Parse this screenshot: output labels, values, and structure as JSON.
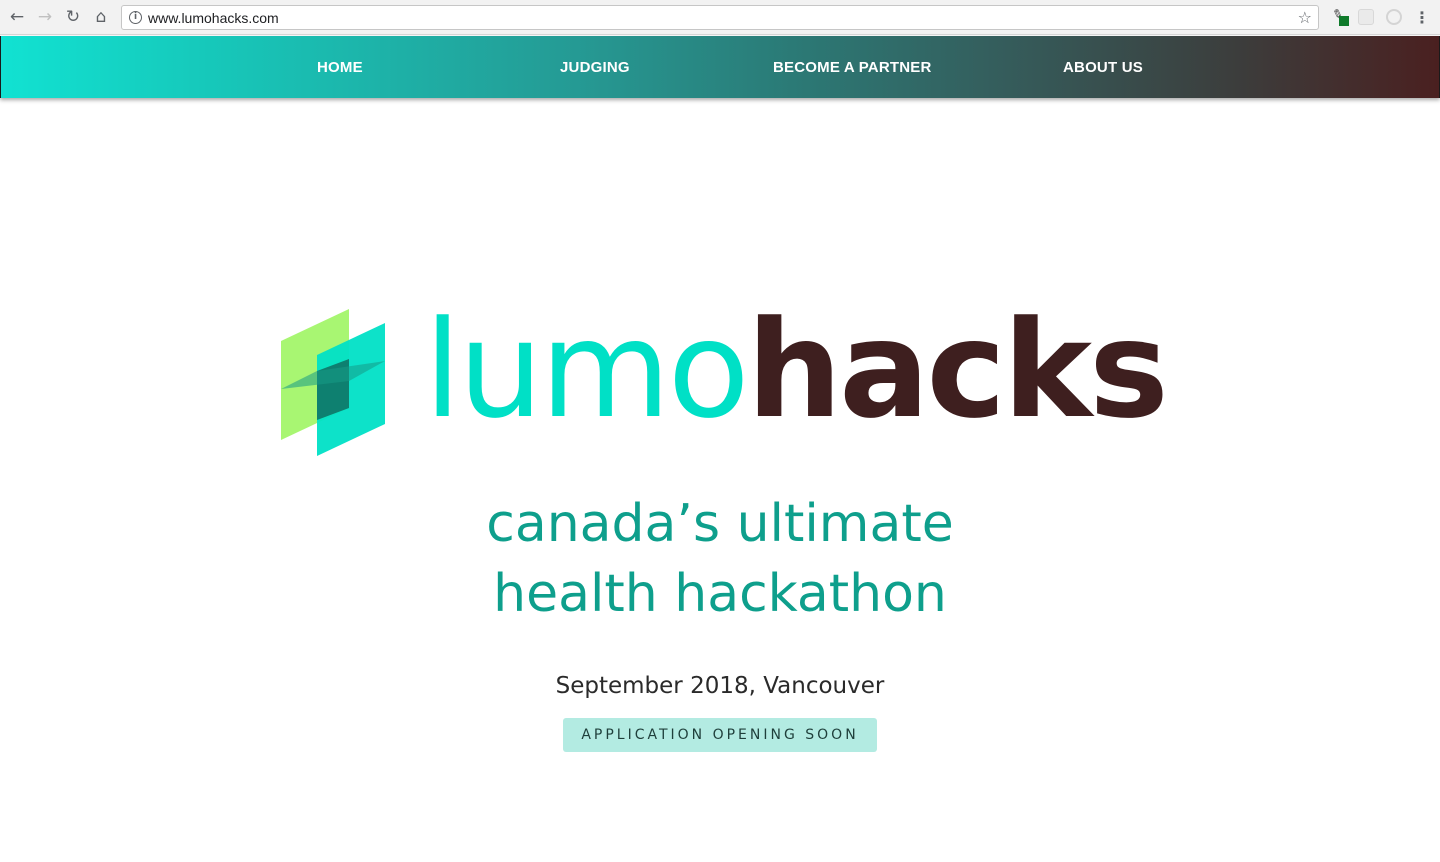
{
  "browser": {
    "back_icon": "←",
    "forward_icon": "→",
    "reload_icon": "↻",
    "home_icon": "⌂",
    "url": "www.lumohacks.com",
    "info_icon": "i",
    "star_icon": "☆",
    "menu_icon": "⋮"
  },
  "nav": {
    "items": [
      {
        "label": "HOME"
      },
      {
        "label": "JUDGING"
      },
      {
        "label": "BECOME A PARTNER"
      },
      {
        "label": "ABOUT US"
      }
    ],
    "gradient_start": "#11e2d2",
    "gradient_end": "#4a2020"
  },
  "hero": {
    "logo_part1": "lumo",
    "logo_part2": "hacks",
    "tagline_line1": "canada’s ultimate",
    "tagline_line2": "health hackathon",
    "date_location": "September 2018, Vancouver",
    "cta_label": "APPLICATION OPENING SOON"
  },
  "colors": {
    "lumo": "#00e0c6",
    "hacks": "#3e1f1f",
    "tagline": "#0e9f8c",
    "cta_bg": "#b3ebe2"
  }
}
